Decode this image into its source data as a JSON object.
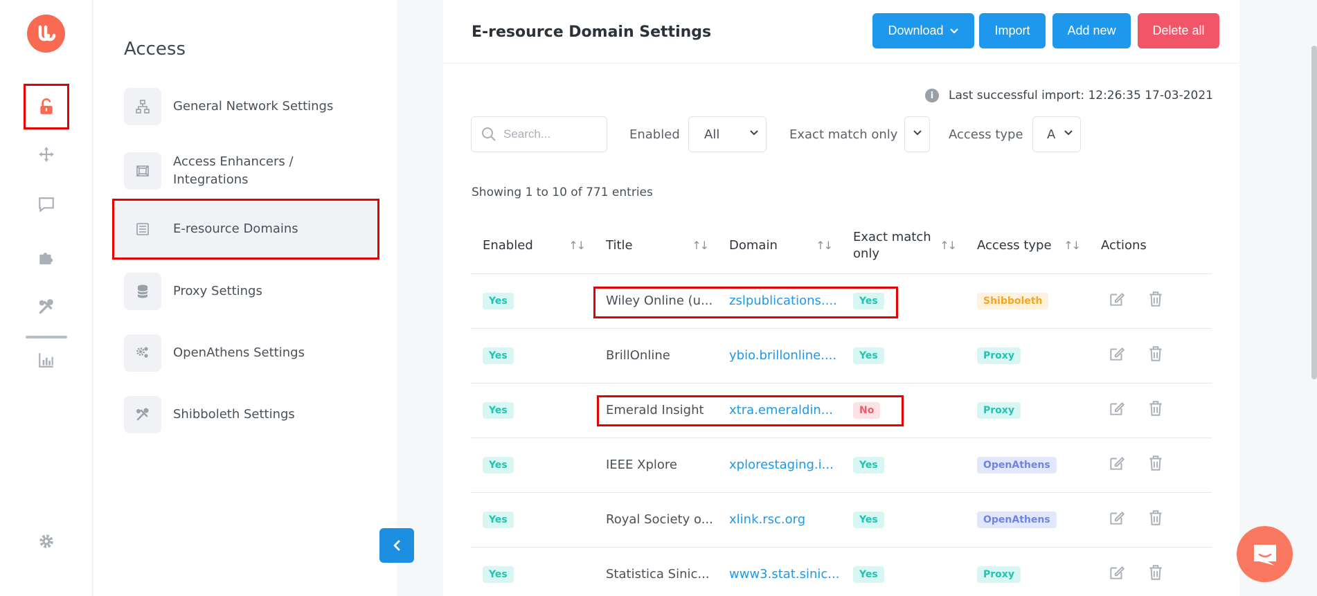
{
  "rail": {
    "items": [
      {
        "name": "lock-icon"
      },
      {
        "name": "move-icon"
      },
      {
        "name": "chat-icon"
      },
      {
        "name": "puzzle-icon"
      },
      {
        "name": "tools-icon"
      },
      {
        "name": "chart-icon"
      },
      {
        "name": "gear-icon"
      }
    ]
  },
  "subnav": {
    "title": "Access",
    "items": [
      {
        "label": "General Network Settings",
        "icon": "network-icon"
      },
      {
        "label": "Access Enhancers / Integrations",
        "icon": "integration-icon"
      },
      {
        "label": "E-resource Domains",
        "icon": "list-icon"
      },
      {
        "label": "Proxy Settings",
        "icon": "database-icon"
      },
      {
        "label": "OpenAthens Settings",
        "icon": "cogs-icon"
      },
      {
        "label": "Shibboleth Settings",
        "icon": "tools-icon"
      }
    ]
  },
  "main": {
    "title": "E-resource Domain Settings",
    "buttons": {
      "download": "Download",
      "import": "Import",
      "add_new": "Add new",
      "delete_all": "Delete all"
    },
    "last_import": "Last successful import: 12:26:35 17-03-2021",
    "filters": {
      "search_placeholder": "Search...",
      "enabled_label": "Enabled",
      "enabled_value": "All",
      "exact_label": "Exact match only",
      "exact_value": "",
      "access_label": "Access type",
      "access_value": "A"
    },
    "showing": "Showing 1 to 10 of 771 entries",
    "columns": [
      "Enabled",
      "Title",
      "Domain",
      "Exact match only",
      "Access type",
      "Actions"
    ],
    "rows": [
      {
        "enabled": "Yes",
        "title": "Wiley Online (u...",
        "domain": "zslpublications....",
        "exact": "Yes",
        "access": "Shibboleth"
      },
      {
        "enabled": "Yes",
        "title": "BrillOnline",
        "domain": "ybio.brillonline....",
        "exact": "Yes",
        "access": "Proxy"
      },
      {
        "enabled": "Yes",
        "title": "Emerald Insight",
        "domain": "xtra.emeraldin...",
        "exact": "No",
        "access": "Proxy"
      },
      {
        "enabled": "Yes",
        "title": "IEEE Xplore",
        "domain": "xplorestaging.i...",
        "exact": "Yes",
        "access": "OpenAthens"
      },
      {
        "enabled": "Yes",
        "title": "Royal Society o...",
        "domain": "xlink.rsc.org",
        "exact": "Yes",
        "access": "OpenAthens"
      },
      {
        "enabled": "Yes",
        "title": "Statistica Sinic...",
        "domain": "www3.stat.sinic...",
        "exact": "Yes",
        "access": "Proxy"
      }
    ]
  },
  "colors": {
    "accent": "#1d98ec",
    "danger": "#f15567",
    "brand": "#f86a52",
    "highlight": "#e60000"
  }
}
